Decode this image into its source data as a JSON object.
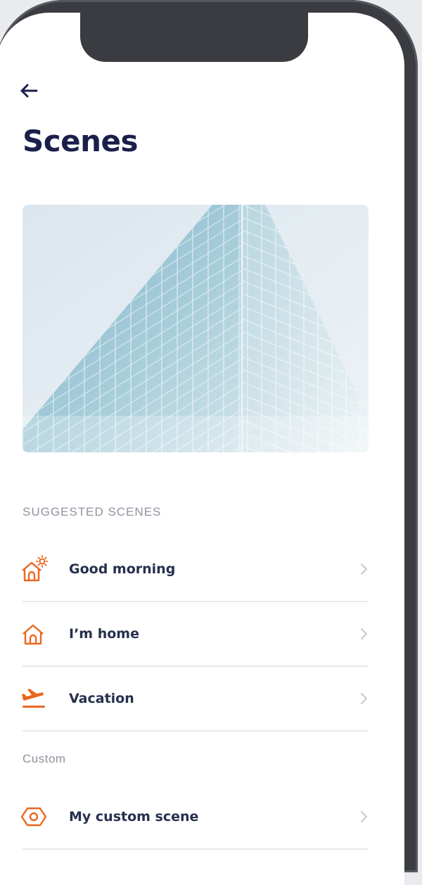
{
  "header": {
    "title": "Scenes"
  },
  "sections": {
    "suggested_label": "SUGGESTED SCENES",
    "custom_label": "Custom"
  },
  "suggested": [
    {
      "label": "Good morning",
      "icon": "house-sun-icon"
    },
    {
      "label": "I’m home",
      "icon": "house-icon"
    },
    {
      "label": "Vacation",
      "icon": "airplane-departure-icon"
    }
  ],
  "custom": [
    {
      "label": "My custom scene",
      "icon": "hexagon-icon"
    }
  ],
  "colors": {
    "accent": "#e8671f",
    "title": "#1b1f4b",
    "row_text": "#26304d",
    "muted": "#8f939e",
    "divider": "#e8e9ec"
  }
}
